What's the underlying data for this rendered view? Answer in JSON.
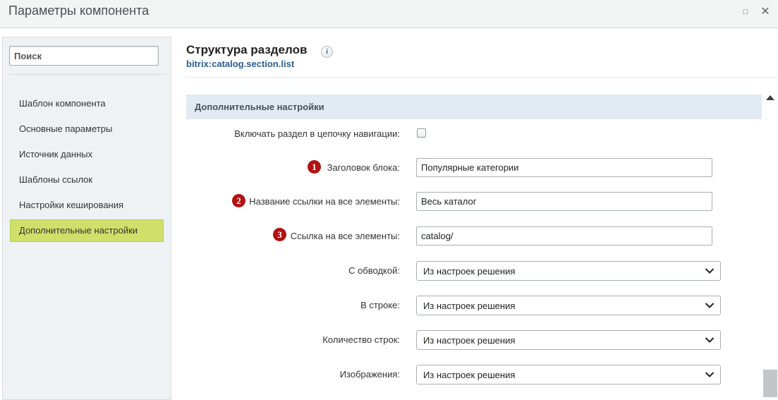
{
  "window": {
    "title": "Параметры компонента",
    "maximize_icon": "maximize-icon",
    "close_icon": "close-icon"
  },
  "sidebar": {
    "search_placeholder": "Поиск",
    "items": [
      {
        "label": "Шаблон компонента",
        "active": false
      },
      {
        "label": "Основные параметры",
        "active": false
      },
      {
        "label": "Источник данных",
        "active": false
      },
      {
        "label": "Шаблоны ссылок",
        "active": false
      },
      {
        "label": "Настройки кеширования",
        "active": false
      },
      {
        "label": "Дополнительные настройки",
        "active": true
      }
    ],
    "active_color": "#cfe06a"
  },
  "main": {
    "title": "Структура разделов",
    "info_icon": "i",
    "component_code": "bitrix:catalog.section.list",
    "section_title": "Дополнительные настройки",
    "fields": {
      "nav_chain": {
        "label": "Включать раздел в цепочку навигации:",
        "checked": false
      },
      "block_title": {
        "badge": "1",
        "label": "Заголовок блока:",
        "value": "Популярные категории"
      },
      "all_link_name": {
        "badge": "2",
        "label": "Название ссылки на все элементы:",
        "value": "Весь каталог"
      },
      "all_link_url": {
        "badge": "3",
        "label": "Ссылка на все элементы:",
        "value": "catalog/"
      },
      "bordered": {
        "label": "С обводкой:",
        "value": "Из настроек решения"
      },
      "in_row": {
        "label": "В строке:",
        "value": "Из настроек решения"
      },
      "row_count": {
        "label": "Количество строк:",
        "value": "Из настроек решения"
      },
      "images": {
        "label": "Изображения:",
        "value": "Из настроек решения"
      }
    }
  },
  "colors": {
    "badge": "#b11214",
    "section_bar": "#e2ebf3",
    "code_link": "#2b5d8f"
  }
}
